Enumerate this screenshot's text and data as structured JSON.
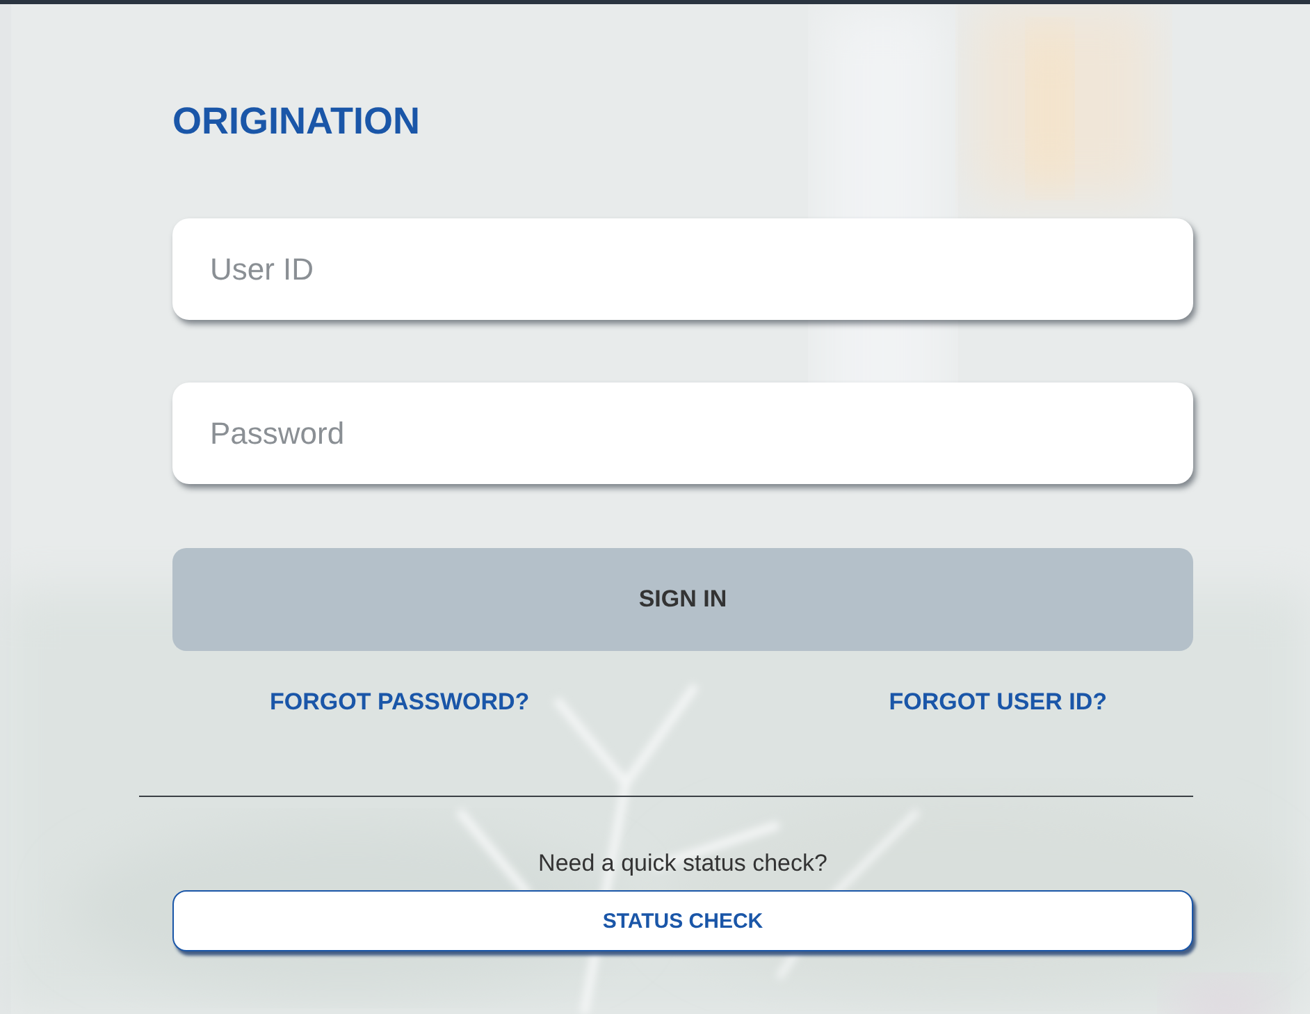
{
  "title": "ORIGINATION",
  "fields": [
    {
      "placeholder": "User ID"
    },
    {
      "placeholder": "Password"
    }
  ],
  "sign_in": {
    "label": "SIGN IN",
    "disabled": true
  },
  "links": [
    "FORGOT PASSWORD?",
    "FORGOT USER ID?"
  ],
  "status_prompt": "Need a quick status check?",
  "status_button": {
    "label": "STATUS CHECK"
  }
}
